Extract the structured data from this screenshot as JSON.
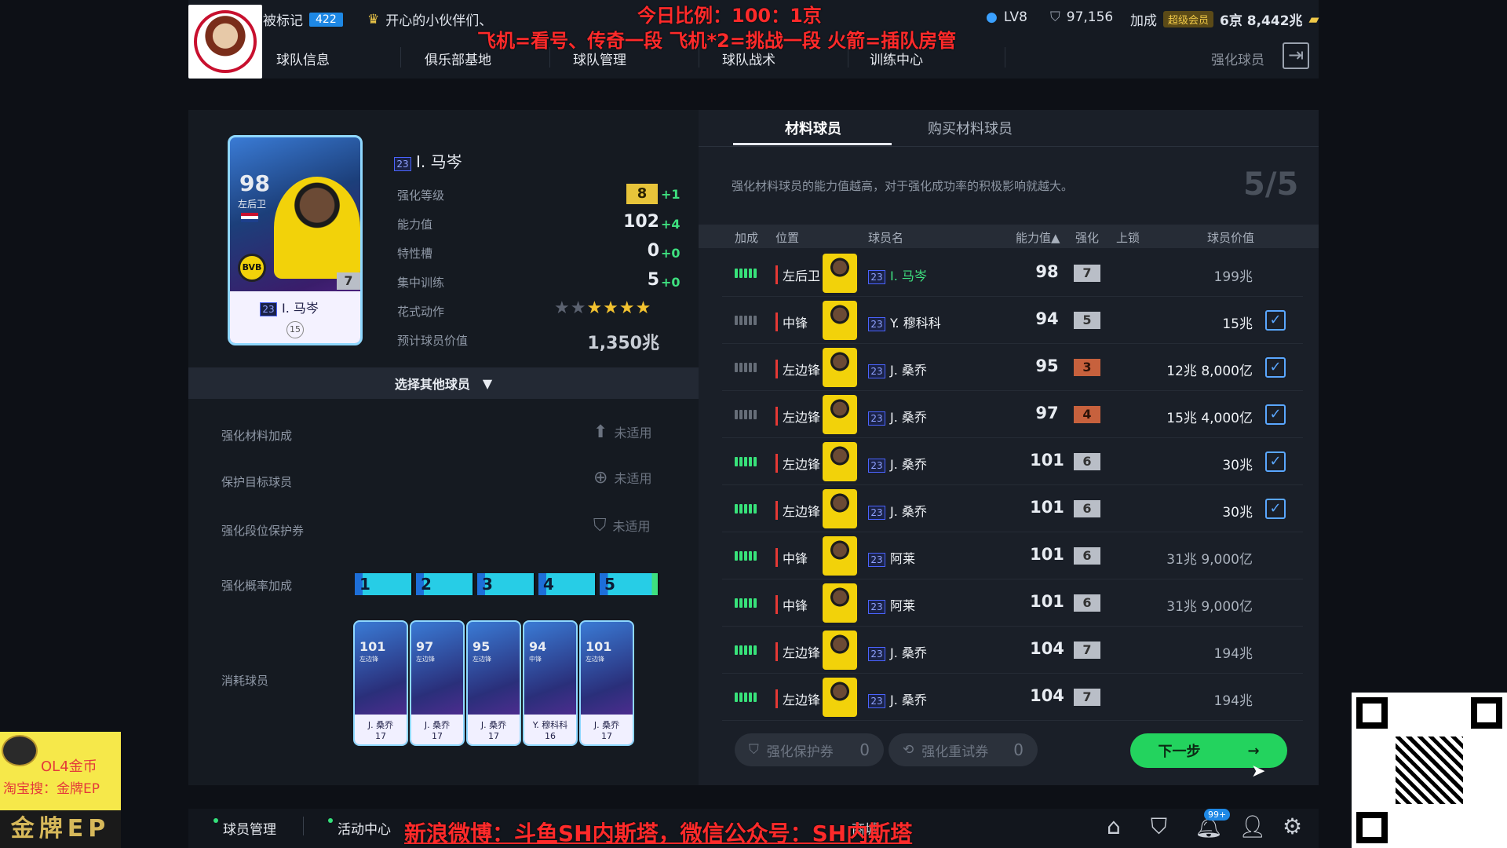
{
  "header": {
    "badge_text": "被标记",
    "badge_count": "422",
    "partner_label": "开心的小伙伴们、",
    "level": "LV8",
    "coins": "97,156",
    "boost_label": "加成",
    "vip_label": "超级会员",
    "currency": "6京 8,442兆",
    "overlay_line1": "今日比例：100：1京",
    "overlay_line2": "飞机=看号、传奇一段  飞机*2=挑战一段  火箭=插队房管",
    "nav": [
      "球队信息",
      "俱乐部基地",
      "球队管理",
      "球队战术",
      "训练中心"
    ],
    "right_link": "强化球员"
  },
  "player": {
    "card_ovr": "98",
    "card_pos": "左后卫",
    "card_level": "7",
    "card_name": "I. 马岑",
    "card_season": "23",
    "card_num": "15",
    "season": "23",
    "name": "I. 马岑",
    "stats": [
      {
        "label": "强化等级",
        "value": "8",
        "plus": "+1"
      },
      {
        "label": "能力值",
        "value": "102",
        "plus": "+4"
      },
      {
        "label": "特性槽",
        "value": "0",
        "plus": "+0"
      },
      {
        "label": "集中训练",
        "value": "5",
        "plus": "+0"
      },
      {
        "label": "花式动作",
        "stars_filled": 4,
        "stars_total": 6
      },
      {
        "label": "预计球员价值",
        "value": "1,350兆"
      }
    ],
    "select_other": "选择其他球员"
  },
  "options": [
    {
      "label": "强化材料加成",
      "status": "未适用"
    },
    {
      "label": "保护目标球员",
      "status": "未适用"
    },
    {
      "label": "强化段位保护券",
      "status": "未适用"
    }
  ],
  "probability": {
    "label": "强化概率加成",
    "segments": [
      "1",
      "2",
      "3",
      "4",
      "5"
    ]
  },
  "consumed": {
    "label": "消耗球员",
    "cards": [
      {
        "ovr": "101",
        "pos": "左边锋",
        "name": "J. 桑乔",
        "num": "17"
      },
      {
        "ovr": "97",
        "pos": "左边锋",
        "name": "J. 桑乔",
        "num": "17"
      },
      {
        "ovr": "95",
        "pos": "左边锋",
        "name": "J. 桑乔",
        "num": "17"
      },
      {
        "ovr": "94",
        "pos": "中锋",
        "name": "Y. 穆科科",
        "num": "16"
      },
      {
        "ovr": "101",
        "pos": "左边锋",
        "name": "J. 桑乔",
        "num": "17"
      }
    ]
  },
  "right": {
    "tabs": [
      "材料球员",
      "购买材料球员"
    ],
    "hint": "强化材料球员的能力值越高，对于强化成功率的积极影响就越大。",
    "count": "5/5",
    "columns": [
      "加成",
      "位置",
      "球员名",
      "能力值▲",
      "强化",
      "上锁",
      "球员价值"
    ],
    "rows": [
      {
        "pos": "左后卫",
        "season": "23",
        "name": "I. 马岑",
        "ovr": "98",
        "grade": "7",
        "value": "199兆",
        "checked": false,
        "green": true,
        "highlight": true
      },
      {
        "pos": "中锋",
        "season": "23",
        "name": "Y. 穆科科",
        "ovr": "94",
        "grade": "5",
        "value": "15兆",
        "checked": true,
        "green": false
      },
      {
        "pos": "左边锋",
        "season": "23",
        "name": "J. 桑乔",
        "ovr": "95",
        "grade": "3",
        "value": "12兆 8,000亿",
        "checked": true,
        "green": false,
        "bronze": true
      },
      {
        "pos": "左边锋",
        "season": "23",
        "name": "J. 桑乔",
        "ovr": "97",
        "grade": "4",
        "value": "15兆 4,000亿",
        "checked": true,
        "green": false,
        "bronze": true
      },
      {
        "pos": "左边锋",
        "season": "23",
        "name": "J. 桑乔",
        "ovr": "101",
        "grade": "6",
        "value": "30兆",
        "checked": true,
        "green": true
      },
      {
        "pos": "左边锋",
        "season": "23",
        "name": "J. 桑乔",
        "ovr": "101",
        "grade": "6",
        "value": "30兆",
        "checked": true,
        "green": true
      },
      {
        "pos": "中锋",
        "season": "23",
        "name": "阿莱",
        "ovr": "101",
        "grade": "6",
        "value": "31兆 9,000亿",
        "checked": false,
        "green": true
      },
      {
        "pos": "中锋",
        "season": "23",
        "name": "阿莱",
        "ovr": "101",
        "grade": "6",
        "value": "31兆 9,000亿",
        "checked": false,
        "green": true
      },
      {
        "pos": "左边锋",
        "season": "23",
        "name": "J. 桑乔",
        "ovr": "104",
        "grade": "7",
        "value": "194兆",
        "checked": false,
        "green": true
      },
      {
        "pos": "左边锋",
        "season": "23",
        "name": "J. 桑乔",
        "ovr": "104",
        "grade": "7",
        "value": "194兆",
        "checked": false,
        "green": true
      }
    ],
    "protect_btn": "强化保护券",
    "protect_count": "0",
    "retry_btn": "强化重试券",
    "retry_count": "0",
    "next_btn": "下一步",
    "next_arrow": "→"
  },
  "bottom": {
    "nav": [
      "球员管理",
      "活动中心",
      "商城"
    ],
    "overlay": "新浪微博：斗鱼SH内斯塔，微信公众号：SH内斯塔",
    "notif_badge": "99+"
  },
  "ad": {
    "line1": "OL4金币",
    "line2": "淘宝搜：金牌EP",
    "logo_text": "金牌EP"
  }
}
